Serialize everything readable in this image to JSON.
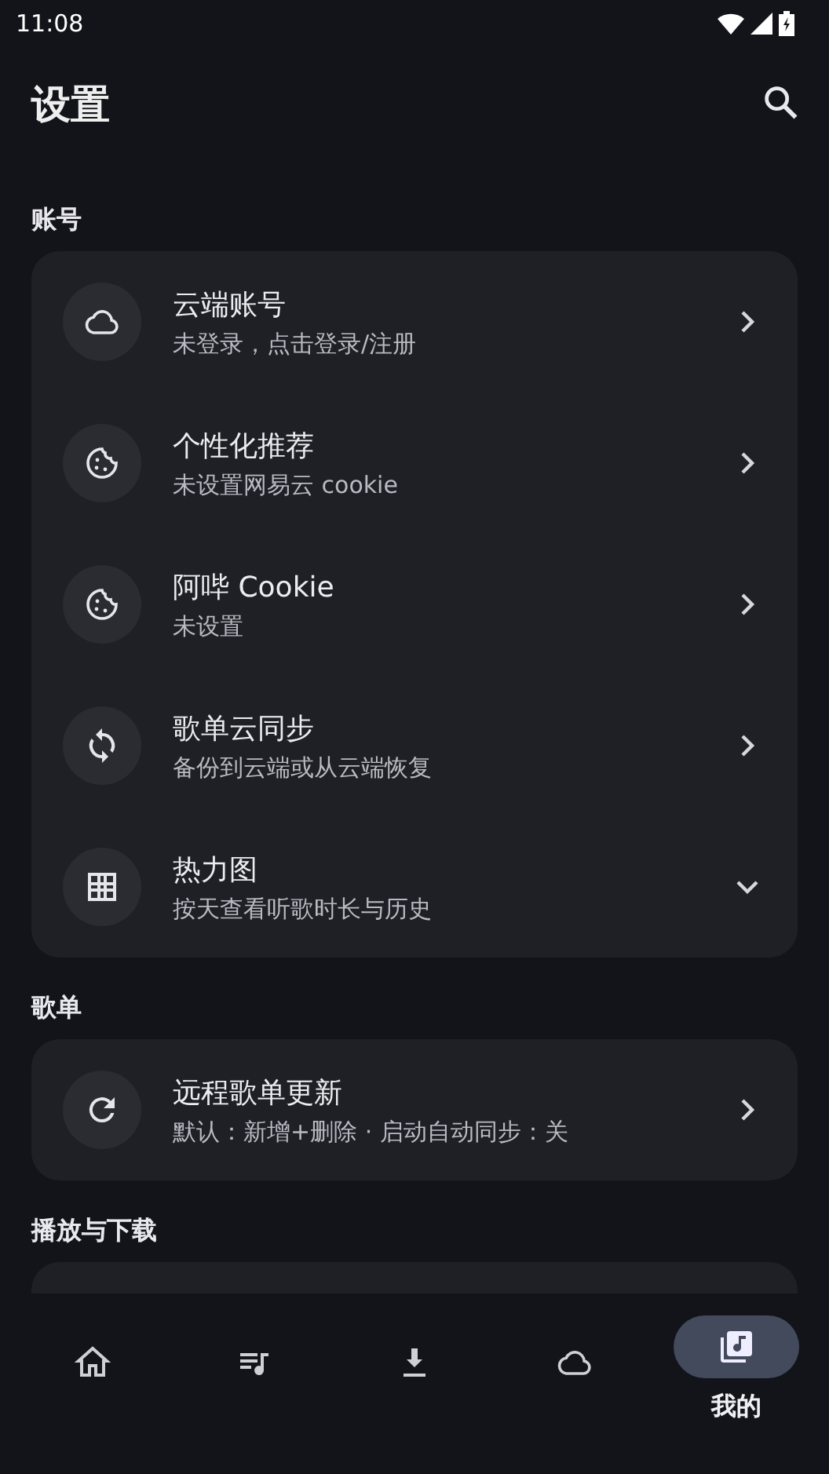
{
  "status_bar": {
    "time": "11:08"
  },
  "header": {
    "title": "设置"
  },
  "sections": [
    {
      "title": "账号",
      "items": [
        {
          "kind": "link",
          "title": "云端账号",
          "subtitle": "未登录，点击登录/注册"
        },
        {
          "kind": "link",
          "title": "个性化推荐",
          "subtitle": "未设置网易云 cookie"
        },
        {
          "kind": "link",
          "title": "阿哔 Cookie",
          "subtitle": "未设置"
        },
        {
          "kind": "link",
          "title": "歌单云同步",
          "subtitle": "备份到云端或从云端恢复"
        },
        {
          "kind": "expandable",
          "expanded": false,
          "title": "热力图",
          "subtitle": "按天查看听歌时长与历史"
        }
      ]
    },
    {
      "title": "歌单",
      "items": [
        {
          "kind": "link",
          "title": "远程歌单更新",
          "subtitle": "默认：新增+删除 · 启动自动同步：关"
        }
      ]
    },
    {
      "title": "播放与下载"
    }
  ],
  "bottom_nav": [
    {
      "selected": false
    },
    {
      "selected": false
    },
    {
      "selected": false
    },
    {
      "selected": false
    },
    {
      "label": "我的",
      "selected": true
    }
  ]
}
